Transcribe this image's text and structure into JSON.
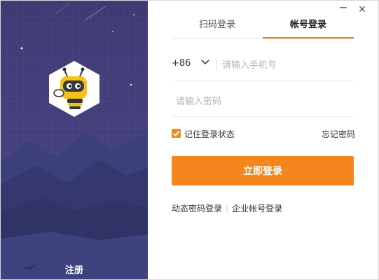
{
  "window": {
    "minimize_symbol": "−",
    "close_symbol": "✕"
  },
  "left_panel": {
    "logo_icon": "bee-mascot-icon",
    "register_label": "注册"
  },
  "tabs": [
    {
      "label": "扫码登录",
      "active": false
    },
    {
      "label": "帐号登录",
      "active": true
    }
  ],
  "form": {
    "country_code": "+86",
    "phone_placeholder": "请输入手机号",
    "password_placeholder": "请输入密码",
    "remember_label": "记住登录状态",
    "remember_checked": true,
    "forgot_label": "忘记密码",
    "submit_label": "立即登录"
  },
  "alt_logins": {
    "dynamic_pwd": "动态密码登录",
    "enterprise": "企业帐号登录"
  },
  "colors": {
    "accent": "#f5861f",
    "left_bg": "#413d79"
  }
}
